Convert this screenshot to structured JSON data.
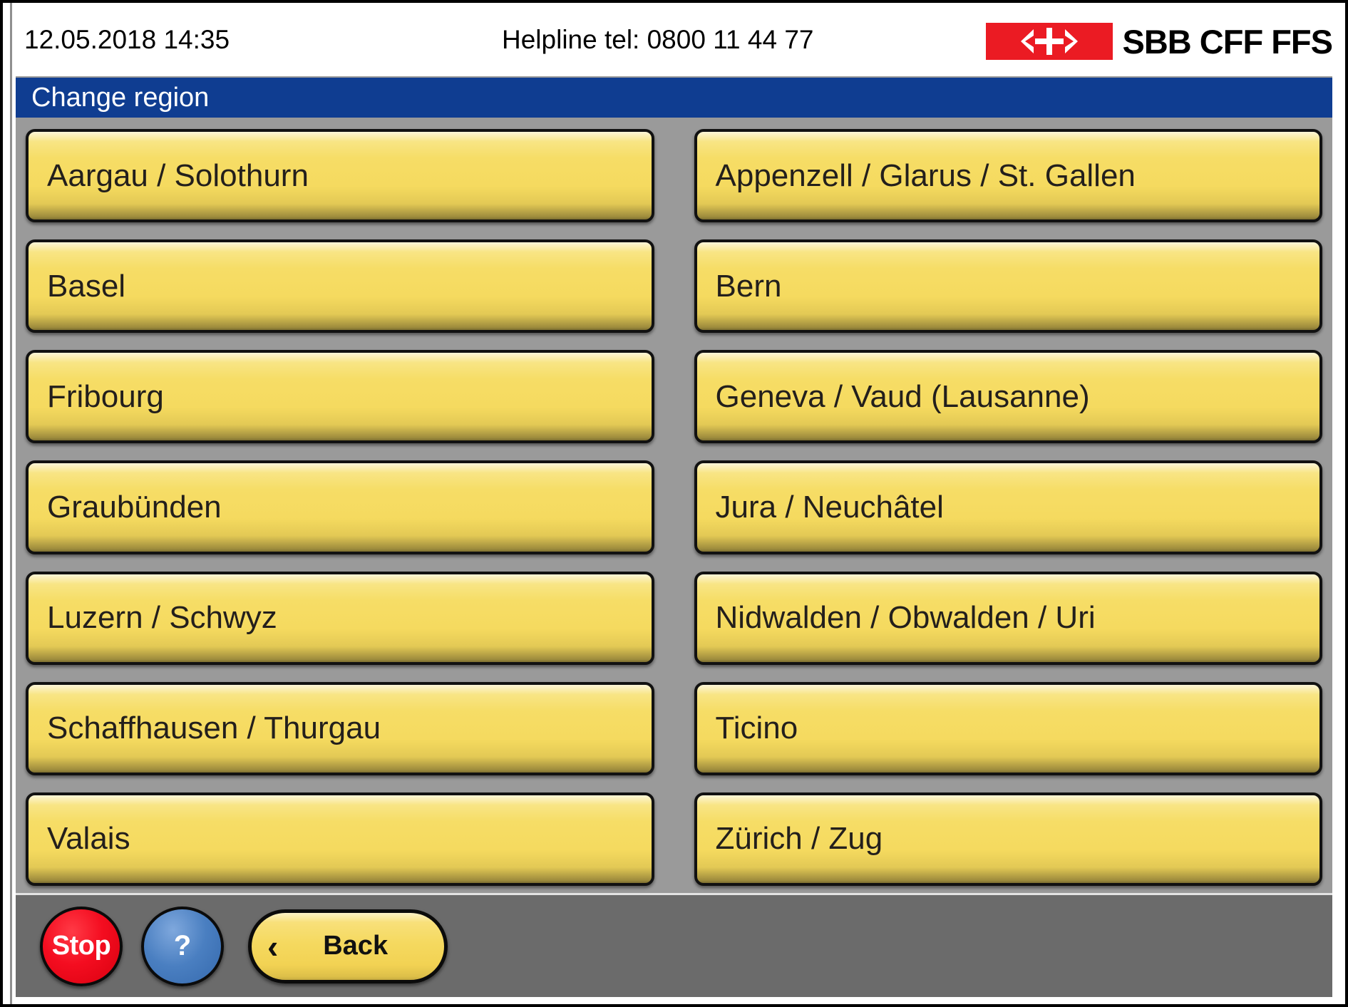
{
  "statusbar": {
    "datetime": "12.05.2018 14:35",
    "helpline": "Helpline tel: 0800 11 44 77",
    "logo_wordmark": "SBB CFF FFS",
    "logo_bg_color": "#eb1b23"
  },
  "titlebar": {
    "title": "Change region",
    "bg_color": "#0f3d91",
    "text_color": "#ffffff"
  },
  "regions": {
    "left_column": [
      {
        "label": "Aargau / Solothurn"
      },
      {
        "label": "Basel"
      },
      {
        "label": "Fribourg"
      },
      {
        "label": "Graubünden"
      },
      {
        "label": "Luzern / Schwyz"
      },
      {
        "label": "Schaffhausen / Thurgau"
      },
      {
        "label": "Valais"
      }
    ],
    "right_column": [
      {
        "label": "Appenzell / Glarus / St. Gallen"
      },
      {
        "label": "Bern"
      },
      {
        "label": "Geneva / Vaud (Lausanne)"
      },
      {
        "label": "Jura / Neuchâtel"
      },
      {
        "label": "Nidwalden / Obwalden / Uri"
      },
      {
        "label": "Ticino"
      },
      {
        "label": "Zürich / Zug"
      }
    ],
    "button_color": "#f5da5f"
  },
  "toolbar": {
    "stop_label": "Stop",
    "stop_color": "#f40d20",
    "help_label": "?",
    "help_color": "#4a7fc1",
    "back_label": "Back",
    "back_chevron": "‹",
    "bg_color": "#6b6b6b"
  }
}
